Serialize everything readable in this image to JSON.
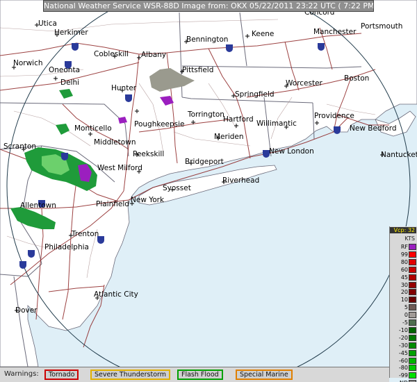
{
  "header": {
    "title": "National Weather Service WSR-88D Image from: OKX 05/22/2011  23:22 UTC  ( 7:22 PM EDT)"
  },
  "colors": {
    "map_bg": "#dfeff7",
    "land": "#ffffff",
    "roads": "#8b2020",
    "borders": "#6a6a7a",
    "range_ring": "#1f3a4a",
    "radar_green": "#1f9b3a",
    "radar_light_green": "#6cd06c",
    "radar_purple": "#9b1fbf",
    "radar_gray": "#9a9a8e"
  },
  "cities": [
    {
      "id": "utica",
      "name": "Utica"
    },
    {
      "id": "herkimer",
      "name": "Herkimer"
    },
    {
      "id": "cobleskill",
      "name": "Cobleskill"
    },
    {
      "id": "albany",
      "name": "Albany"
    },
    {
      "id": "bennington",
      "name": "Bennington"
    },
    {
      "id": "keene",
      "name": "Keene"
    },
    {
      "id": "concord",
      "name": "Concord"
    },
    {
      "id": "manchester",
      "name": "Manchester"
    },
    {
      "id": "portsmouth",
      "name": "Portsmouth"
    },
    {
      "id": "norwich",
      "name": "Norwich"
    },
    {
      "id": "oneonta",
      "name": "Oneonta"
    },
    {
      "id": "delhi",
      "name": "Delhi"
    },
    {
      "id": "pittsfield",
      "name": "Pittsfield"
    },
    {
      "id": "hunter",
      "name": "Hunter"
    },
    {
      "id": "springfield",
      "name": "Springfield"
    },
    {
      "id": "worcester",
      "name": "Worcester"
    },
    {
      "id": "boston",
      "name": "Boston"
    },
    {
      "id": "monticello",
      "name": "Monticello"
    },
    {
      "id": "poughkeepsie",
      "name": "Poughkeepsie"
    },
    {
      "id": "torrington",
      "name": "Torrington"
    },
    {
      "id": "hartford",
      "name": "Hartford"
    },
    {
      "id": "willimantic",
      "name": "Willimantic"
    },
    {
      "id": "providence",
      "name": "Providence"
    },
    {
      "id": "new-bedford",
      "name": "New Bedford"
    },
    {
      "id": "scranton",
      "name": "Scranton"
    },
    {
      "id": "middletown-ny",
      "name": "Middletown"
    },
    {
      "id": "meriden",
      "name": "Meriden"
    },
    {
      "id": "new-london",
      "name": "New London"
    },
    {
      "id": "nantucket",
      "name": "Nantucket"
    },
    {
      "id": "peekskill",
      "name": "Peekskill"
    },
    {
      "id": "bridgeport",
      "name": "Bridgeport"
    },
    {
      "id": "riverhead",
      "name": "Riverhead"
    },
    {
      "id": "west-milford",
      "name": "West Milford"
    },
    {
      "id": "syosset",
      "name": "Syosset"
    },
    {
      "id": "allentown",
      "name": "Allentown"
    },
    {
      "id": "plainfield",
      "name": "Plainfield"
    },
    {
      "id": "new-york",
      "name": "New York"
    },
    {
      "id": "trenton",
      "name": "Trenton"
    },
    {
      "id": "philadelphia",
      "name": "Philadelphia"
    },
    {
      "id": "atlantic-city",
      "name": "Atlantic City"
    },
    {
      "id": "dover",
      "name": "Dover"
    }
  ],
  "legend": {
    "header_units": "Vcp: 32",
    "header_kts": "KTS",
    "entries": [
      {
        "label": "RF",
        "color": "#9b1fbf"
      },
      {
        "label": "99",
        "color": "#ff0000"
      },
      {
        "label": "80",
        "color": "#e00000"
      },
      {
        "label": "60",
        "color": "#c80000"
      },
      {
        "label": "45",
        "color": "#b00000"
      },
      {
        "label": "30",
        "color": "#960000"
      },
      {
        "label": "20",
        "color": "#800000"
      },
      {
        "label": "10",
        "color": "#6a0000"
      },
      {
        "label": "5",
        "color": "#6e5a55"
      },
      {
        "label": "0",
        "color": "#a09a96"
      },
      {
        "label": "-5",
        "color": "#4e6e4e"
      },
      {
        "label": "-10",
        "color": "#006400"
      },
      {
        "label": "-20",
        "color": "#007800"
      },
      {
        "label": "-30",
        "color": "#008c00"
      },
      {
        "label": "-45",
        "color": "#00a000"
      },
      {
        "label": "-60",
        "color": "#00b400"
      },
      {
        "label": "-80",
        "color": "#00c800"
      },
      {
        "label": "-99",
        "color": "#00e000"
      },
      {
        "label": "ND",
        "color": "#8c8c8c"
      }
    ]
  },
  "warnings": {
    "title": "Warnings:",
    "items": [
      {
        "label": "Tornado",
        "color": "#cc0000"
      },
      {
        "label": "Severe Thunderstorm",
        "color": "#e0b000"
      },
      {
        "label": "Flash Flood",
        "color": "#00a000"
      },
      {
        "label": "Special Marine",
        "color": "#e08000"
      }
    ]
  }
}
